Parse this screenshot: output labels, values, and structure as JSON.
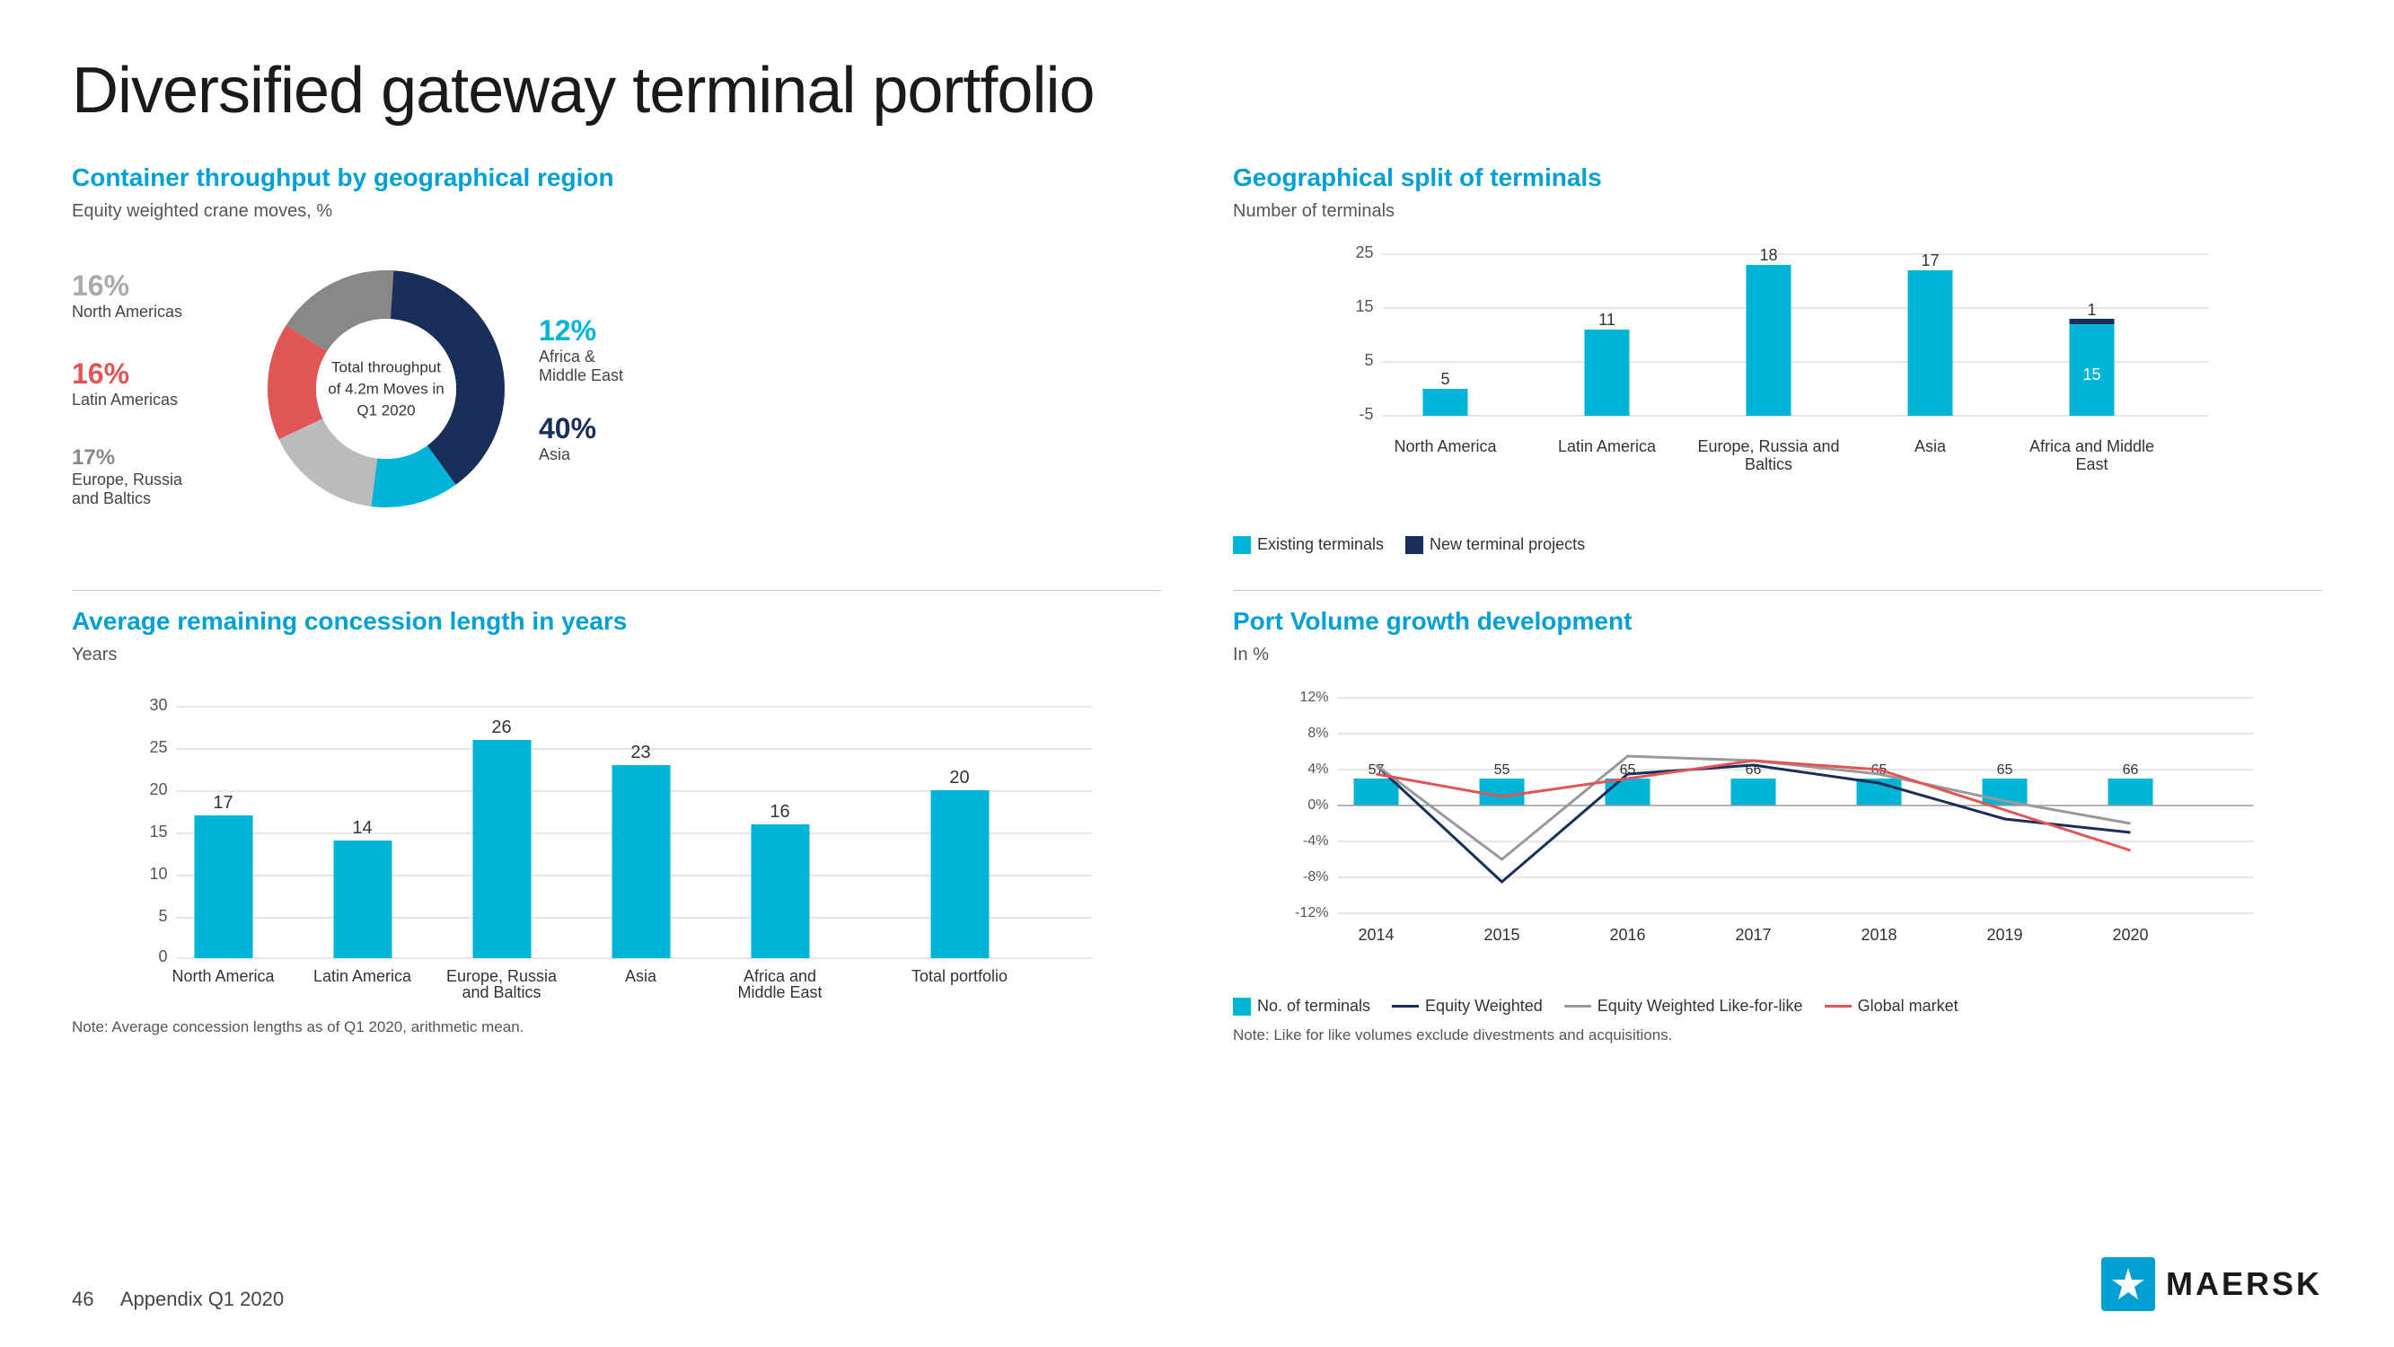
{
  "page": {
    "title": "Diversified gateway terminal portfolio",
    "page_number": "46",
    "appendix": "Appendix Q1 2020"
  },
  "donut_section": {
    "title": "Container throughput by geographical region",
    "subtitle": "Equity weighted crane moves, %",
    "center_text": "Total throughput of 4.2m Moves in Q1 2020",
    "segments": [
      {
        "label": "Asia",
        "pct": 40,
        "color": "#1a2e5a",
        "text_color": "#1a2e5a",
        "start": 0
      },
      {
        "label": "Africa & Middle East",
        "pct": 12,
        "color": "#00b4d8",
        "text_color": "#00b4d8",
        "start": 40
      },
      {
        "label": "North Americas",
        "pct": 16,
        "color": "#bbb",
        "text_color": "#aaa",
        "start": 52
      },
      {
        "label": "Latin Americas",
        "pct": 16,
        "color": "#e05555",
        "text_color": "#e05555",
        "start": 68
      },
      {
        "label": "Europe, Russia and Baltics",
        "pct": 17,
        "color": "#888",
        "text_color": "#888",
        "start": 84
      }
    ]
  },
  "geo_split": {
    "title": "Geographical split of terminals",
    "subtitle": "Number of terminals",
    "y_max": 25,
    "y_min": -5,
    "y_ticks": [
      25,
      15,
      5,
      -5
    ],
    "categories": [
      "North America",
      "Latin America",
      "Europe, Russia and Baltics",
      "Asia",
      "Africa and Middle East"
    ],
    "existing": [
      5,
      11,
      18,
      17,
      15
    ],
    "new_projects": [
      0,
      0,
      0,
      0,
      1
    ],
    "legend": {
      "existing_label": "Existing terminals",
      "new_label": "New terminal projects"
    }
  },
  "concession": {
    "title": "Average remaining concession length in years",
    "y_label": "Years",
    "y_max": 30,
    "y_ticks": [
      30,
      25,
      20,
      15,
      10,
      5,
      0
    ],
    "categories": [
      "North America",
      "Latin America",
      "Europe, Russia\nand Baltics",
      "Asia",
      "Africa and\nMiddle East",
      "Total portfolio"
    ],
    "values": [
      17,
      14,
      26,
      23,
      16,
      20
    ],
    "note": "Note: Average concession lengths as of Q1 2020, arithmetic mean."
  },
  "port_volume": {
    "title": "Port Volume growth development",
    "y_label": "In %",
    "y_ticks": [
      "12%",
      "8%",
      "4%",
      "0%",
      "-4%",
      "-8%",
      "-12%"
    ],
    "years": [
      "2014",
      "2015",
      "2016",
      "2017",
      "2018",
      "2019",
      "2020"
    ],
    "bar_values": [
      57,
      55,
      65,
      66,
      65,
      65,
      66
    ],
    "equity_weighted": [
      4.5,
      -8.5,
      3.5,
      4.5,
      2.5,
      -1.5,
      -3.0
    ],
    "equity_like_for_like": [
      4.5,
      -6.0,
      5.5,
      5.0,
      3.5,
      0.5,
      -2.0
    ],
    "global_market": [
      3.5,
      1.0,
      3.0,
      5.0,
      4.0,
      -0.5,
      -5.0
    ],
    "legend": {
      "bar_label": "No. of terminals",
      "equity_label": "Equity Weighted",
      "like_label": "Equity Weighted Like-for-like",
      "global_label": "Global market"
    },
    "note": "Note: Like for like volumes exclude divestments and acquisitions."
  }
}
